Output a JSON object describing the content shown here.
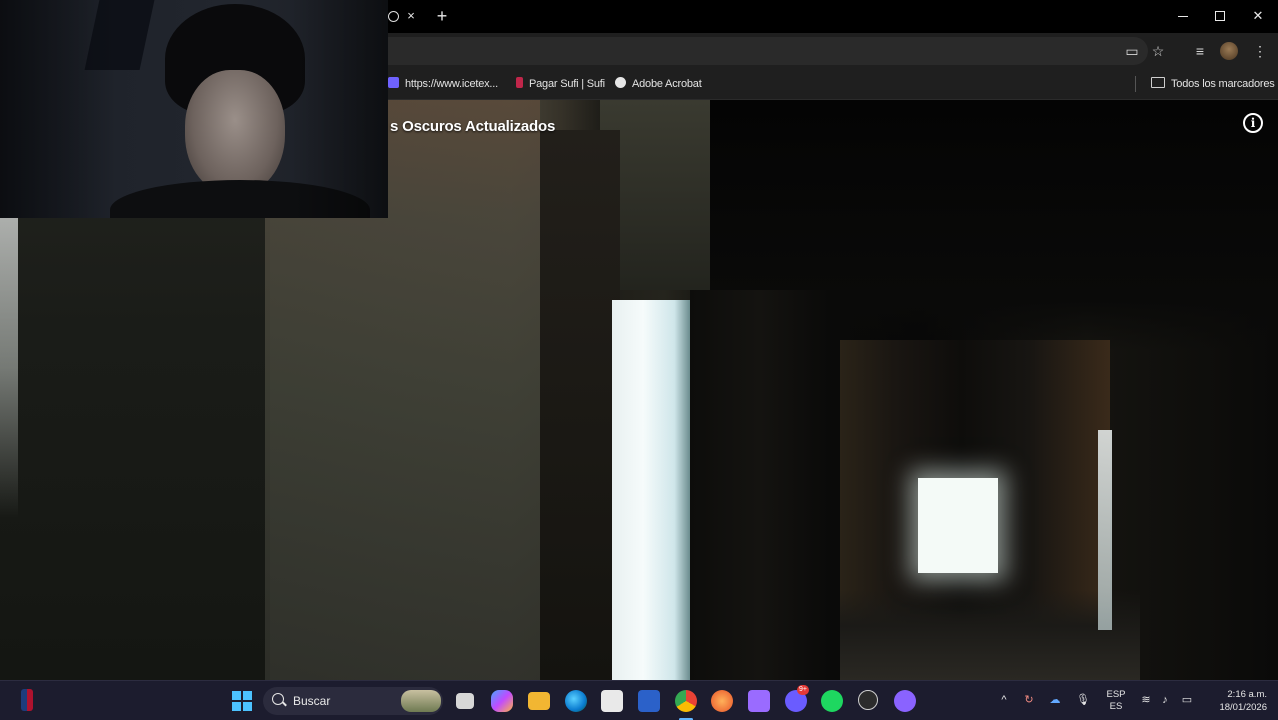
{
  "browser": {
    "tab_close": "×",
    "new_tab": "+",
    "window": {
      "minimize": "",
      "maximize": "",
      "close": "✕"
    },
    "toolbar_icons": [
      "cast-icon",
      "star-icon",
      "extensions-icon",
      "profile-icon",
      "menu-icon"
    ],
    "bookmarks": [
      {
        "label": "https://www.icetex...",
        "icon": "icetex-icon",
        "color": "#6f62ff"
      },
      {
        "label": "Pagar Sufi | Sufi",
        "icon": "bookmark-icon",
        "color": "#c0264a"
      },
      {
        "label": "Adobe Acrobat",
        "icon": "globe-icon",
        "color": "#e6e6e6"
      }
    ],
    "all_bookmarks": "Todos los marcadores"
  },
  "video": {
    "title": "s Oscuros Actualizados",
    "info": "i"
  },
  "taskbar": {
    "search_label": "Buscar",
    "apps": [
      "nba-icon",
      "windows-start-icon",
      "search-icon",
      "task-view-icon",
      "copilot-icon",
      "file-explorer-icon",
      "edge-icon",
      "store-icon",
      "word-icon",
      "chrome-icon",
      "app-icon",
      "game-icon",
      "discord-icon",
      "spotify-icon",
      "app-icon",
      "messenger-icon"
    ],
    "discord_badge": "9+",
    "language_top": "ESP",
    "language_bottom": "ES",
    "time": "2:16 a.m.",
    "date": "18/01/2026"
  }
}
